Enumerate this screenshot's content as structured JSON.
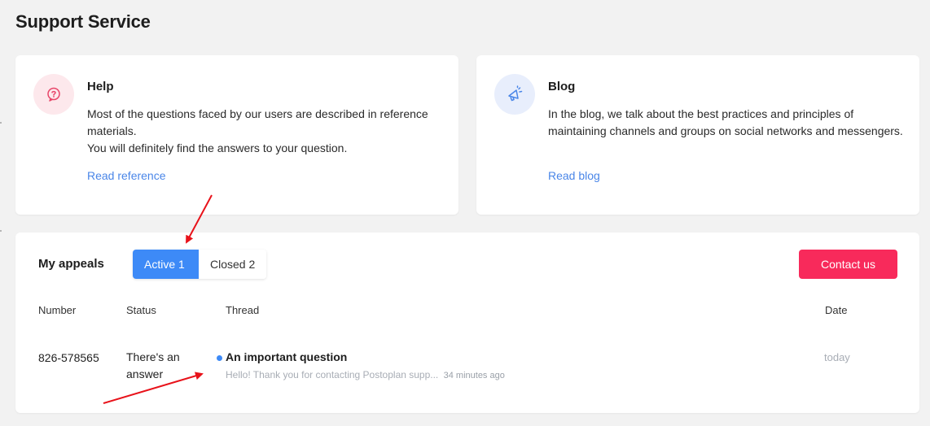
{
  "page": {
    "title": "Support Service"
  },
  "help_card": {
    "title": "Help",
    "text_lines": [
      "Most of the questions faced by our users are described in reference materials.",
      "You will definitely find the answers to your question."
    ],
    "link": "Read reference",
    "icon": "question-bubble-icon"
  },
  "blog_card": {
    "title": "Blog",
    "text": "In the blog, we talk about the best practices and principles of maintaining channels and groups on social networks and messengers.",
    "link": "Read blog",
    "icon": "megaphone-icon"
  },
  "appeals": {
    "title": "My appeals",
    "tabs": [
      {
        "label": "Active 1",
        "active": true
      },
      {
        "label": "Closed 2",
        "active": false
      }
    ],
    "contact_button": "Contact us",
    "columns": [
      "Number",
      "Status",
      "Thread",
      "Date"
    ],
    "rows": [
      {
        "number": "826-578565",
        "status": "There's an answer",
        "thread_title": "An important question",
        "thread_preview": "Hello! Thank you for contacting Postoplan supp...",
        "thread_time": "34 minutes ago",
        "date": "today",
        "unread": true
      }
    ]
  },
  "colors": {
    "accent_blue": "#3d8af7",
    "contact_red": "#f82a5b",
    "link_blue": "#4a86e8",
    "annotation_red": "#e8121a"
  }
}
